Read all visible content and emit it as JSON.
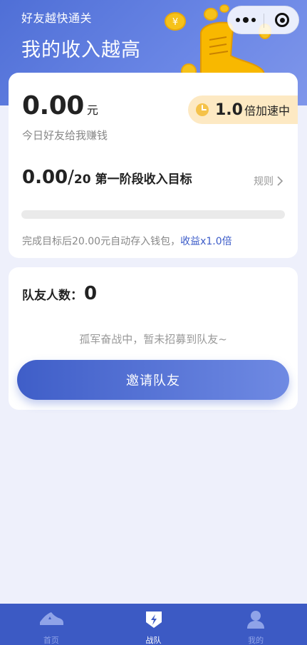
{
  "header": {
    "subtitle": "好友越快通关",
    "title": "我的收入越高"
  },
  "capsule": {
    "more_icon": "more-dots-icon",
    "close_icon": "mini-program-close-icon"
  },
  "income": {
    "amount": "0.00",
    "unit": "元",
    "label": "今日好友给我赚钱",
    "speed_value": "1.0",
    "speed_text": "倍加速中"
  },
  "target": {
    "current": "0.00",
    "separator": "/",
    "total": "20",
    "label": "第一阶段收入目标",
    "rules_label": "规则",
    "progress": 0,
    "note_prefix": "完成目标后20.00元自动存入钱包，",
    "note_highlight": "收益x1.0倍"
  },
  "team": {
    "label": "队友人数：",
    "count": "0",
    "empty_tip": "孤军奋战中，暂未招募到队友~",
    "invite_label": "邀请队友"
  },
  "tabbar": {
    "tabs": [
      {
        "label": "首页",
        "icon": "sneaker-icon",
        "active": false
      },
      {
        "label": "战队",
        "icon": "team-shield-icon",
        "active": true
      },
      {
        "label": "我的",
        "icon": "user-icon",
        "active": false
      }
    ]
  },
  "colors": {
    "primary": "#4f6fd6",
    "tabbar": "#3c5ac4",
    "badge_bg": "#fde9c3",
    "link": "#3b5bc8"
  }
}
